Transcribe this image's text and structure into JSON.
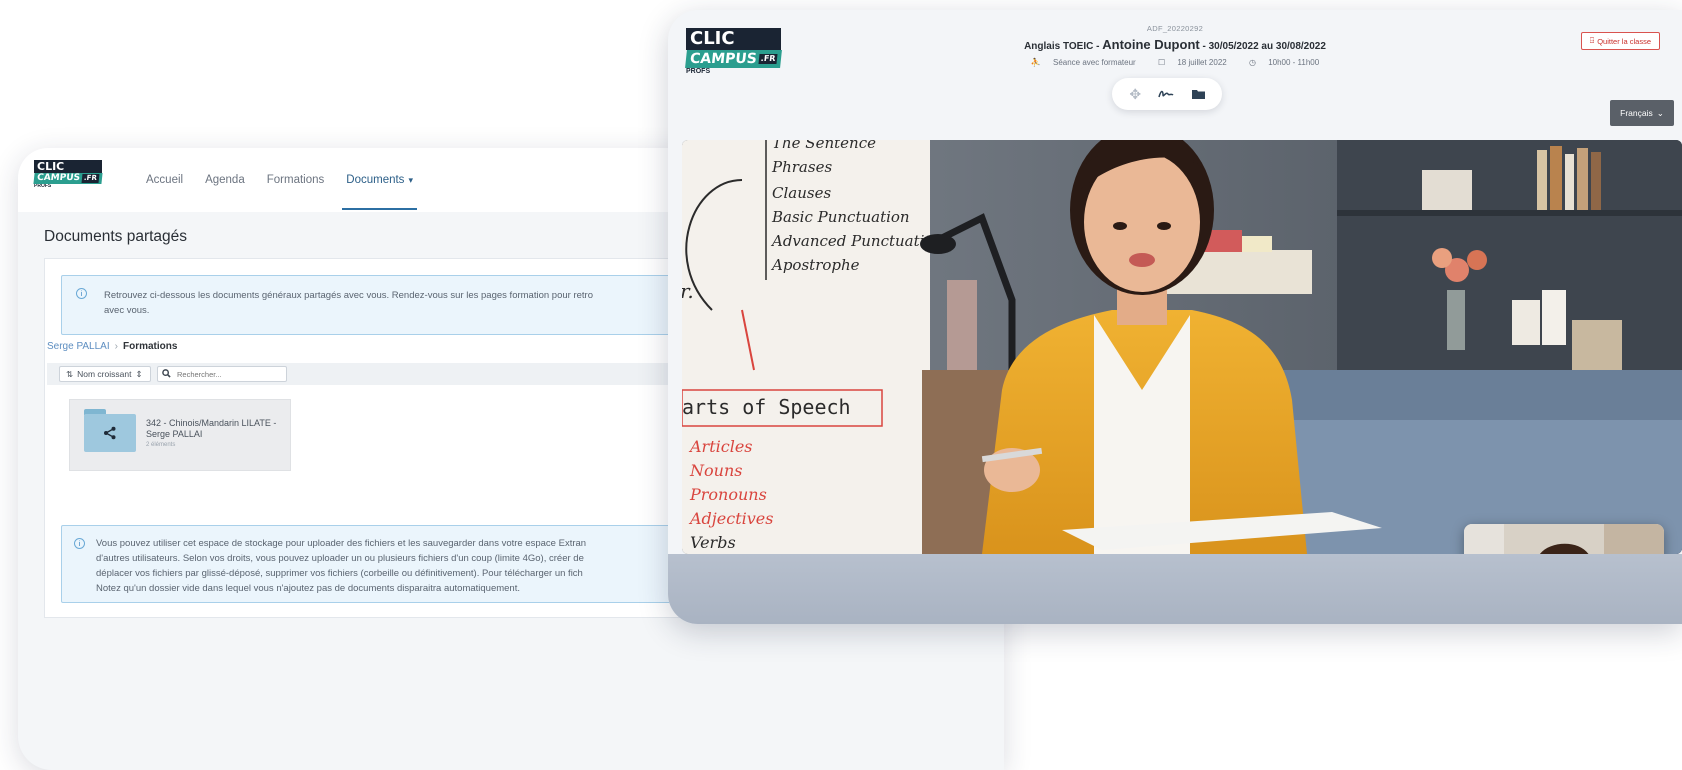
{
  "brand": {
    "clic": "CLIC",
    "campus": "CAMPUS",
    "fr": ".FR",
    "profs": "PROFS",
    "colors": {
      "dark": "#1a2433",
      "teal": "#2b9e8f",
      "accent_blue": "#2c6fa3"
    }
  },
  "docs_window": {
    "nav": {
      "items": [
        "Accueil",
        "Agenda",
        "Formations"
      ],
      "active": "Documents",
      "active_caret": "▾"
    },
    "heading": "Documents partagés",
    "info_top": [
      "Retrouvez ci-dessous les documents généraux partagés avec vous. Rendez-vous sur les pages formation pour retro",
      "avec vous."
    ],
    "breadcrumb": {
      "root": "Serge PALLAI",
      "sep": "›",
      "current": "Formations"
    },
    "sort": {
      "icon": "⇅",
      "label": "Nom croissant",
      "caret": "⇕"
    },
    "search": {
      "placeholder": "Rechercher..."
    },
    "folder": {
      "icon": "share-icon",
      "title": "342 - Chinois/Mandarin LILATE - Serge PALLAI",
      "subtitle": "2 éléments"
    },
    "info_bottom": [
      "Vous pouvez utiliser cet espace de stockage pour uploader des fichiers et les sauvegarder dans votre espace Extran",
      "d'autres utilisateurs. Selon vos droits, vous pouvez uploader un ou plusieurs fichiers d'un coup (limite 4Go), créer de",
      "déplacer vos fichiers par glissé-déposé, supprimer vos fichiers (corbeille ou définitivement). Pour télécharger un fich",
      "Notez qu'un dossier vide dans lequel vous n'ajoutez pas de documents disparaitra automatiquement."
    ]
  },
  "class_window": {
    "ref": "ADF_20220292",
    "course_prefix": "Anglais TOEIC - ",
    "teacher": "Antoine Dupont",
    "dates": " - 30/05/2022 au 30/08/2022",
    "session_type": "Séance avec formateur",
    "date": "18 juillet 2022",
    "time": "10h00 - 11h00",
    "tools": {
      "move_icon": "move-icon",
      "draw_icon": "signature-icon",
      "folder_icon": "folder-icon"
    },
    "quit_label": "Quitter la classe",
    "language": "Français",
    "whiteboard": {
      "top_lines": [
        "The Sentence",
        "Phrases",
        "Clauses",
        "Basic Punctuation",
        "Advanced Punctuation",
        "Apostrophe"
      ],
      "fragment": "r.",
      "parts_title": "arts of Speech",
      "parts": [
        "Articles",
        "Nouns",
        "Pronouns",
        "Adjectives",
        "Verbs"
      ],
      "check": "©"
    }
  }
}
